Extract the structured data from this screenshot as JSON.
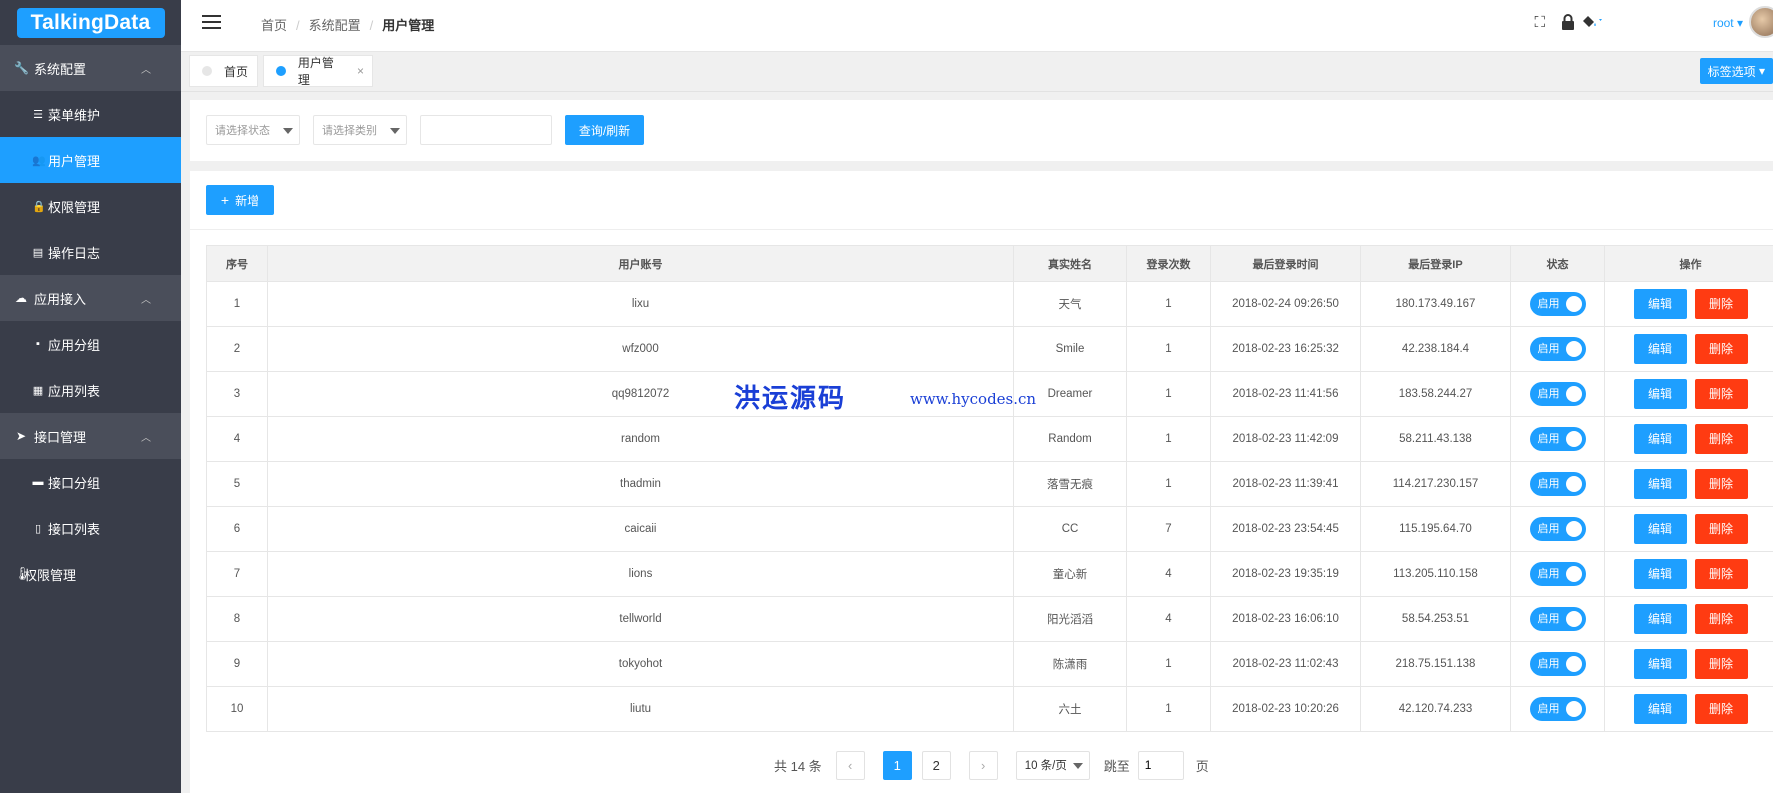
{
  "logo": "TalkingData",
  "sidebar": {
    "groups": [
      {
        "label": "系统配置",
        "items": [
          "菜单维护",
          "用户管理",
          "权限管理",
          "操作日志"
        ]
      },
      {
        "label": "应用接入",
        "items": [
          "应用分组",
          "应用列表"
        ]
      },
      {
        "label": "接口管理",
        "items": [
          "接口分组",
          "接口列表"
        ]
      }
    ],
    "plain": "权限管理",
    "active": "用户管理"
  },
  "breadcrumb": [
    "首页",
    "系统配置",
    "用户管理"
  ],
  "user": "root",
  "tabs": [
    {
      "label": "首页",
      "active": false
    },
    {
      "label": "用户管理",
      "active": true,
      "close": "×"
    }
  ],
  "tab_options": "标签选项",
  "filter": {
    "status_placeholder": "请选择状态",
    "type_placeholder": "请选择类别",
    "query_button": "查询/刷新"
  },
  "add_button": "新增",
  "table": {
    "headers": [
      "序号",
      "用户账号",
      "真实姓名",
      "登录次数",
      "最后登录时间",
      "最后登录IP",
      "状态",
      "操作"
    ],
    "rows": [
      [
        "1",
        "lixu",
        "天气",
        "1",
        "2018-02-24 09:26:50",
        "180.173.49.167"
      ],
      [
        "2",
        "wfz000",
        "Smile",
        "1",
        "2018-02-23 16:25:32",
        "42.238.184.4"
      ],
      [
        "3",
        "qq9812072",
        "Dreamer",
        "1",
        "2018-02-23 11:41:56",
        "183.58.244.27"
      ],
      [
        "4",
        "random",
        "Random",
        "1",
        "2018-02-23 11:42:09",
        "58.211.43.138"
      ],
      [
        "5",
        "thadmin",
        "落雪无痕",
        "1",
        "2018-02-23 11:39:41",
        "114.217.230.157"
      ],
      [
        "6",
        "caicaii",
        "CC",
        "7",
        "2018-02-23 23:54:45",
        "115.195.64.70"
      ],
      [
        "7",
        "lions",
        "童心新",
        "4",
        "2018-02-23 19:35:19",
        "113.205.110.158"
      ],
      [
        "8",
        "tellworld",
        "阳光滔滔",
        "4",
        "2018-02-23 16:06:10",
        "58.54.253.51"
      ],
      [
        "9",
        "tokyohot",
        "陈潇雨",
        "1",
        "2018-02-23 11:02:43",
        "218.75.151.138"
      ],
      [
        "10",
        "liutu",
        "六土",
        "1",
        "2018-02-23 10:20:26",
        "42.120.74.233"
      ]
    ],
    "status_label": "启用",
    "edit_label": "编辑",
    "delete_label": "删除"
  },
  "pagination": {
    "total": "共 14 条",
    "prev": "‹",
    "pages": [
      "1",
      "2"
    ],
    "next": "›",
    "per_page": "10 条/页",
    "jump_label": "跳至",
    "jump_value": "1",
    "page_suffix": "页"
  },
  "watermark": {
    "cn": "洪运源码",
    "url": "www.hycodes.cn"
  }
}
